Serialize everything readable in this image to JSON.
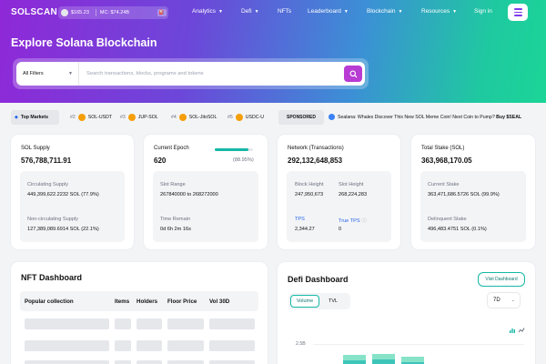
{
  "nav": {
    "logo": "SOLSCAN",
    "sol_price": "$165.23",
    "sol_change": "",
    "market_cap": "MC: $74.24B",
    "links": [
      "Analytics",
      "Defi",
      "NFTs",
      "Leaderboard",
      "Blockchain",
      "Resources",
      "Sign in"
    ]
  },
  "hero": {
    "title": "Explore Solana Blockchain",
    "filter_label": "All Filters",
    "search_placeholder": "Search transactions, blocks, programs and tokens"
  },
  "ticker": {
    "top_label": "Top Markets",
    "items": [
      {
        "rank": "#2",
        "pair": "SOL-USDT"
      },
      {
        "rank": "#3",
        "pair": "JUP-SOL"
      },
      {
        "rank": "#4",
        "pair": "SOL-JitoSOL"
      },
      {
        "rank": "#5",
        "pair": "USDC-U"
      }
    ],
    "sponsored_label": "SPONSORED",
    "ad_text": "Sealana: Whales Discover This New SOL Meme Coin! Next Coin to Pump?",
    "ad_cta": "Buy $SEAL"
  },
  "supply": {
    "label": "SOL Supply",
    "value": "576,788,711.91",
    "circ_label": "Circulating Supply",
    "circ_value": "449,399,622.2232 SOL (77.9%)",
    "noncirc_label": "Non-circulating Supply",
    "noncirc_value": "127,389,089.6914 SOL (22.1%)"
  },
  "epoch": {
    "label": "Current Epoch",
    "value": "620",
    "progress_pct": "(88.95%)",
    "progress_fraction": 0.8895,
    "slot_range_label": "Slot Range",
    "slot_range_value": "267840000 to 268272000",
    "time_remain_label": "Time Remain",
    "time_remain_value": "0d 6h 2m 16s"
  },
  "network": {
    "label": "Network (Transactions)",
    "value": "292,132,648,853",
    "block_height_label": "Block Height",
    "block_height_value": "247,950,673",
    "slot_height_label": "Slot Height",
    "slot_height_value": "268,224,283",
    "tps_label": "TPS",
    "tps_value": "2,344.27",
    "true_tps_label": "True TPS",
    "true_tps_value": "0"
  },
  "stake": {
    "label": "Total Stake (SOL)",
    "value": "363,968,170.05",
    "current_label": "Current Stake",
    "current_value": "363,471,686.5726 SOL (99.9%)",
    "delinquent_label": "Delinquent Stake",
    "delinquent_value": "496,483.4751 SOL (0.1%)"
  },
  "nft": {
    "title": "NFT Dashboard",
    "columns": [
      "Popular collection",
      "Items",
      "Holders",
      "Floor Price",
      "Vol 30D"
    ]
  },
  "defi": {
    "title": "Defi Dashboard",
    "visit_label": "Visit Dashboard",
    "tabs": [
      "Volume",
      "TVL"
    ],
    "period": "7D",
    "y_tick": "2.5B"
  },
  "colors": {
    "accent": "#14b8a6",
    "brand_purple": "#8f28d8",
    "link_blue": "#2563eb"
  }
}
